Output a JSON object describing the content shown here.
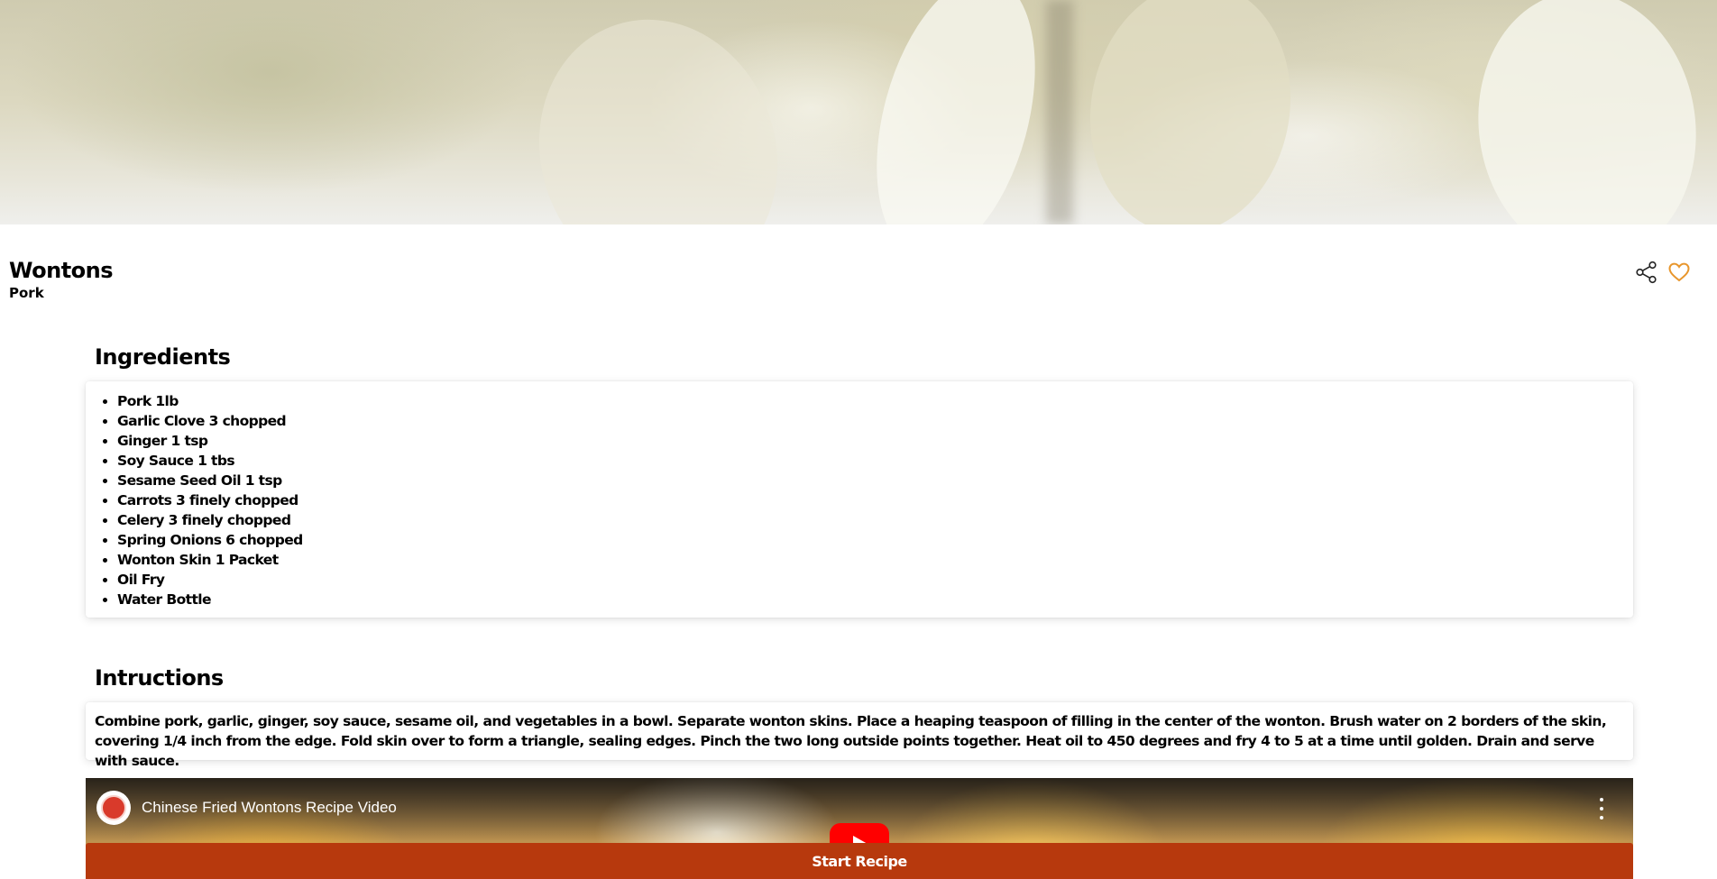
{
  "hero": {
    "image": "wonton-dumplings-photo"
  },
  "recipe": {
    "title": "Wontons",
    "category": "Pork"
  },
  "actions": {
    "share_icon": "share-icon",
    "favorite_icon": "heart-icon",
    "favorite_color": "#e8962c"
  },
  "ingredients": {
    "heading": "Ingredients",
    "items": [
      "Pork 1lb",
      "Garlic Clove 3 chopped",
      "Ginger 1 tsp",
      "Soy Sauce 1 tbs",
      "Sesame Seed Oil 1 tsp",
      "Carrots 3 finely chopped",
      "Celery 3 finely chopped",
      "Spring Onions 6 chopped",
      "Wonton Skin 1 Packet",
      "Oil Fry",
      "Water Bottle"
    ]
  },
  "instructions": {
    "heading": "Intructions",
    "text": "Combine pork, garlic, ginger, soy sauce, sesame oil, and vegetables in a bowl. Separate wonton skins. Place a heaping teaspoon of filling in the center of the wonton. Brush water on 2 borders of the skin, covering 1/4 inch from the edge. Fold skin over to form a triangle, sealing edges. Pinch the two long outside points together. Heat oil to 450 degrees and fry 4 to 5 at a time until golden. Drain and serve with sauce."
  },
  "video": {
    "title": "Chinese Fried Wontons Recipe Video",
    "channel_icon": "channel-logo",
    "play_icon": "play-icon",
    "menu_icon": "more-vertical-icon",
    "play_color": "#ff0000"
  },
  "start_button": {
    "label": "Start Recipe",
    "color": "#b7390d"
  }
}
